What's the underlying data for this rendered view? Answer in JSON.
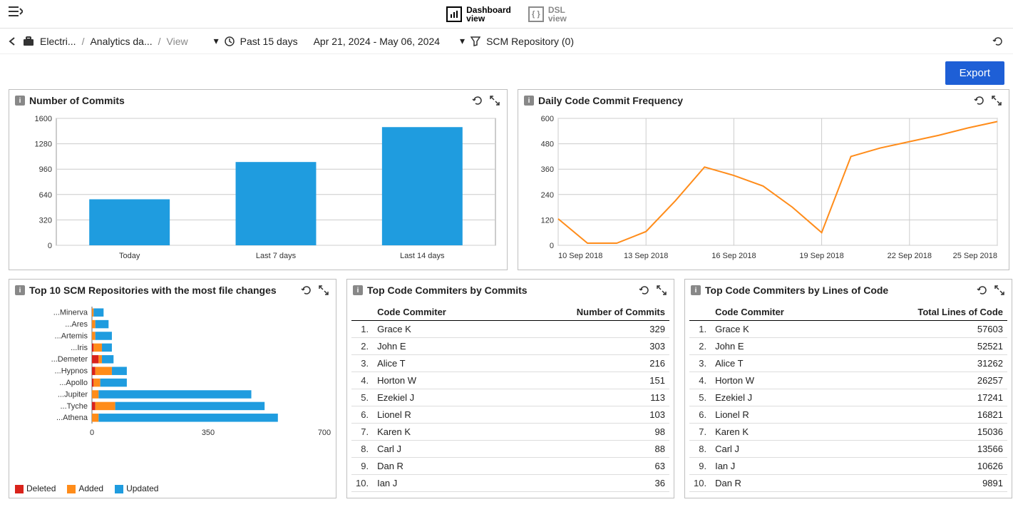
{
  "view_switch": {
    "dashboard_top": "Dashboard",
    "dashboard_bot": "view",
    "dsl_top": "DSL",
    "dsl_bot": "view"
  },
  "breadcrumb": {
    "project": "Electri...",
    "folder": "Analytics da...",
    "page": "View"
  },
  "filters": {
    "time_range_label": "Past 15 days",
    "date_range": "Apr 21, 2024 - May 06, 2024",
    "scm_filter": "SCM Repository (0)"
  },
  "export_label": "Export",
  "panels": {
    "commits_bar": {
      "title": "Number of Commits"
    },
    "daily_line": {
      "title": "Daily Code Commit Frequency"
    },
    "top_repos": {
      "title": "Top 10 SCM Repositories with the most file changes"
    },
    "top_by_commits": {
      "title": "Top Code Commiters by Commits",
      "col1": "Code Commiter",
      "col2": "Number of Commits"
    },
    "top_by_loc": {
      "title": "Top Code Commiters by Lines of Code",
      "col1": "Code Commiter",
      "col2": "Total Lines of Code"
    }
  },
  "legend": {
    "deleted": "Deleted",
    "added": "Added",
    "updated": "Updated"
  },
  "chart_data": [
    {
      "id": "commits_bar",
      "type": "bar",
      "categories": [
        "Today",
        "Last 7 days",
        "Last 14 days"
      ],
      "values": [
        580,
        1050,
        1490
      ],
      "yticks": [
        0,
        320,
        640,
        960,
        1280,
        1600
      ],
      "ylim": [
        0,
        1600
      ]
    },
    {
      "id": "daily_line",
      "type": "line",
      "x": [
        "10 Sep 2018",
        "11 Sep 2018",
        "12 Sep 2018",
        "13 Sep 2018",
        "14 Sep 2018",
        "15 Sep 2018",
        "16 Sep 2018",
        "17 Sep 2018",
        "18 Sep 2018",
        "19 Sep 2018",
        "20 Sep 2018",
        "21 Sep 2018",
        "22 Sep 2018",
        "23 Sep 2018",
        "24 Sep 2018",
        "25 Sep 2018"
      ],
      "xticks": [
        "10 Sep 2018",
        "13 Sep 2018",
        "16 Sep 2018",
        "19 Sep 2018",
        "22 Sep 2018",
        "25 Sep 2018"
      ],
      "values": [
        125,
        10,
        10,
        65,
        210,
        370,
        330,
        280,
        180,
        60,
        420,
        460,
        490,
        520,
        555,
        585
      ],
      "yticks": [
        0,
        120,
        240,
        360,
        480,
        600
      ],
      "ylim": [
        0,
        600
      ]
    },
    {
      "id": "top_repos",
      "type": "bar",
      "orientation": "horizontal",
      "categories": [
        "...Minerva",
        "...Ares",
        "...Artemis",
        "...Iris",
        "...Demeter",
        "...Hypnos",
        "...Apollo",
        "...Jupiter",
        "...Tyche",
        "...Athena"
      ],
      "series": [
        {
          "name": "Deleted",
          "color": "#d9231b",
          "values": [
            0,
            0,
            0,
            5,
            20,
            10,
            5,
            0,
            10,
            0
          ]
        },
        {
          "name": "Added",
          "color": "#ff8c1a",
          "values": [
            5,
            10,
            10,
            25,
            10,
            50,
            20,
            20,
            60,
            20
          ]
        },
        {
          "name": "Updated",
          "color": "#1f9cdf",
          "values": [
            30,
            40,
            50,
            30,
            35,
            45,
            80,
            460,
            450,
            540
          ]
        }
      ],
      "xticks": [
        0,
        350,
        700
      ],
      "xlim": [
        0,
        700
      ]
    },
    {
      "id": "top_by_commits",
      "type": "table",
      "columns": [
        "Code Commiter",
        "Number of Commits"
      ],
      "rows": [
        [
          "Grace K",
          329
        ],
        [
          "John E",
          303
        ],
        [
          "Alice T",
          216
        ],
        [
          "Horton W",
          151
        ],
        [
          "Ezekiel J",
          113
        ],
        [
          "Lionel R",
          103
        ],
        [
          "Karen K",
          98
        ],
        [
          "Carl J",
          88
        ],
        [
          "Dan R",
          63
        ],
        [
          "Ian J",
          36
        ]
      ]
    },
    {
      "id": "top_by_loc",
      "type": "table",
      "columns": [
        "Code Commiter",
        "Total Lines of Code"
      ],
      "rows": [
        [
          "Grace K",
          57603
        ],
        [
          "John E",
          52521
        ],
        [
          "Alice T",
          31262
        ],
        [
          "Horton W",
          26257
        ],
        [
          "Ezekiel J",
          17241
        ],
        [
          "Lionel R",
          16821
        ],
        [
          "Karen K",
          15036
        ],
        [
          "Carl J",
          13566
        ],
        [
          "Ian J",
          10626
        ],
        [
          "Dan R",
          9891
        ]
      ]
    }
  ]
}
